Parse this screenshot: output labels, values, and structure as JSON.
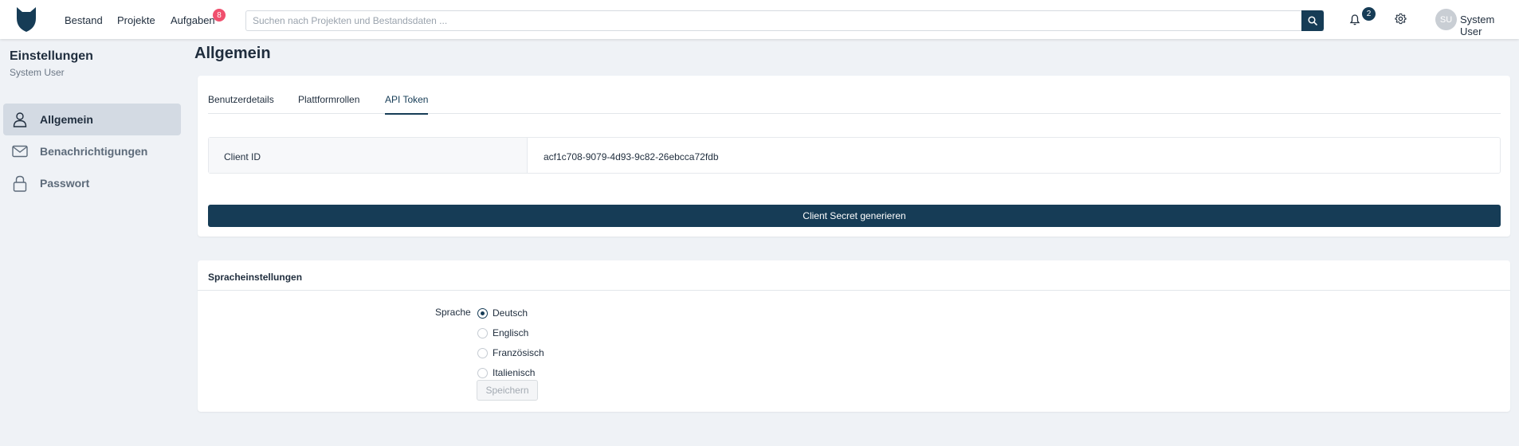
{
  "header": {
    "nav": [
      "Bestand",
      "Projekte",
      "Aufgaben"
    ],
    "tasks_badge": "8",
    "search_placeholder": "Suchen nach Projekten und Bestandsdaten ...",
    "notifications_badge": "2",
    "avatar_initials": "SU",
    "user_name": "System User",
    "icons": [
      "logo-icon",
      "search-icon",
      "bell-icon",
      "gear-icon"
    ]
  },
  "sidebar": {
    "title": "Einstellungen",
    "subtitle": "System User",
    "items": [
      {
        "label": "Allgemein",
        "icon": "user-icon",
        "active": true
      },
      {
        "label": "Benachrichtigungen",
        "icon": "mail-icon",
        "active": false
      },
      {
        "label": "Passwort",
        "icon": "lock-icon",
        "active": false
      }
    ]
  },
  "main": {
    "title": "Allgemein",
    "tabs": [
      {
        "label": "Benutzerdetails",
        "active": false
      },
      {
        "label": "Plattformrollen",
        "active": false
      },
      {
        "label": "API Token",
        "active": true
      }
    ],
    "client_id_label": "Client ID",
    "client_id_value": "acf1c708-9079-4d93-9c82-26ebcca72fdb",
    "generate_button": "Client Secret generieren"
  },
  "language": {
    "header": "Spracheinstellungen",
    "label": "Sprache",
    "options": [
      {
        "label": "Deutsch",
        "selected": true
      },
      {
        "label": "Englisch",
        "selected": false
      },
      {
        "label": "Französisch",
        "selected": false
      },
      {
        "label": "Italienisch",
        "selected": false
      }
    ],
    "save_button": "Speichern"
  },
  "colors": {
    "primary": "#163c56",
    "badge": "#f0506e",
    "background": "#eff2f6"
  }
}
